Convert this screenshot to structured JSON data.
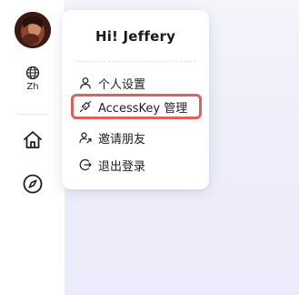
{
  "sidebar": {
    "language_label": "Zh"
  },
  "menu": {
    "greeting": "Hi! Jeffery",
    "items": [
      {
        "label": "个人设置",
        "icon": "user-icon"
      },
      {
        "label": "AccessKey 管理",
        "icon": "key-icon"
      },
      {
        "label": "邀请朋友",
        "icon": "invite-user-icon"
      },
      {
        "label": "退出登录",
        "icon": "logout-icon"
      }
    ],
    "highlight_color": "#e0605a"
  }
}
